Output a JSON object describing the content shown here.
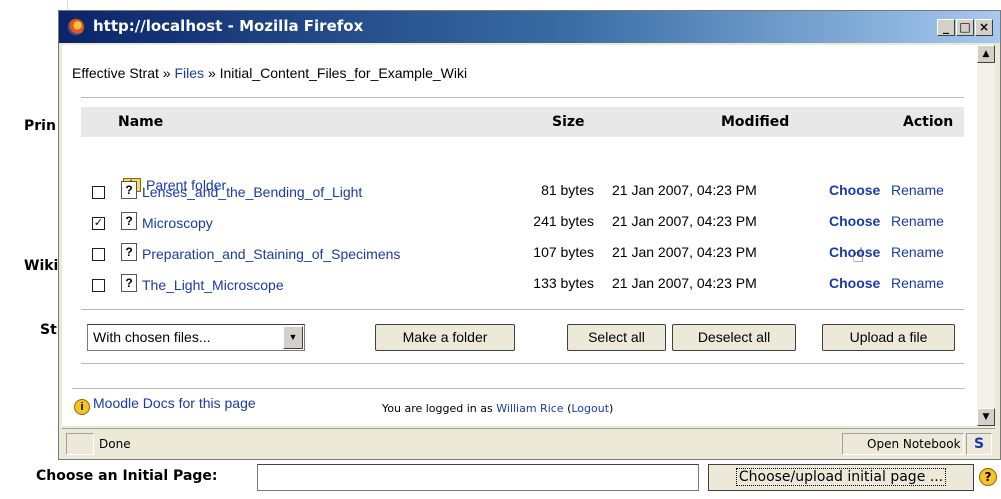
{
  "background_page": {
    "left_labels": [
      "Prin",
      "Wiki",
      "St"
    ],
    "bottom_label": "Choose an Initial Page:",
    "bottom_input_value": "",
    "bottom_button": "Choose/upload initial page ...",
    "help_glyph": "?"
  },
  "window": {
    "title": "http://localhost - Mozilla Firefox",
    "icon": "firefox-icon",
    "controls": {
      "minimize": "_",
      "maximize": "□",
      "close": "×"
    }
  },
  "breadcrumb": {
    "root": "Effective Strat",
    "sep": "»",
    "files": "Files",
    "current": "Initial_Content_Files_for_Example_Wiki"
  },
  "table": {
    "headers": {
      "name": "Name",
      "size": "Size",
      "modified": "Modified",
      "action": "Action"
    },
    "parent_folder": "Parent folder",
    "rows": [
      {
        "checked": false,
        "name": "Lenses_and_the_Bending_of_Light",
        "size": "81 bytes",
        "modified": "21 Jan 2007, 04:23 PM",
        "choose": "Choose",
        "rename": "Rename"
      },
      {
        "checked": true,
        "name": "Microscopy",
        "size": "241 bytes",
        "modified": "21 Jan 2007, 04:23 PM",
        "choose": "Choose",
        "rename": "Rename"
      },
      {
        "checked": false,
        "name": "Preparation_and_Staining_of_Specimens",
        "size": "107 bytes",
        "modified": "21 Jan 2007, 04:23 PM",
        "choose": "Choose",
        "rename": "Rename"
      },
      {
        "checked": false,
        "name": "The_Light_Microscope",
        "size": "133 bytes",
        "modified": "21 Jan 2007, 04:23 PM",
        "choose": "Choose",
        "rename": "Rename"
      }
    ]
  },
  "actions": {
    "with_chosen": "With chosen files...",
    "make_folder": "Make a folder",
    "select_all": "Select all",
    "deselect_all": "Deselect all",
    "upload": "Upload a file"
  },
  "footer": {
    "docs_link": "Moodle Docs for this page",
    "logged_prefix": "You are logged in as",
    "user": "William Rice",
    "logout": "Logout"
  },
  "statusbar": {
    "status": "Done",
    "notebook": "Open Notebook"
  }
}
